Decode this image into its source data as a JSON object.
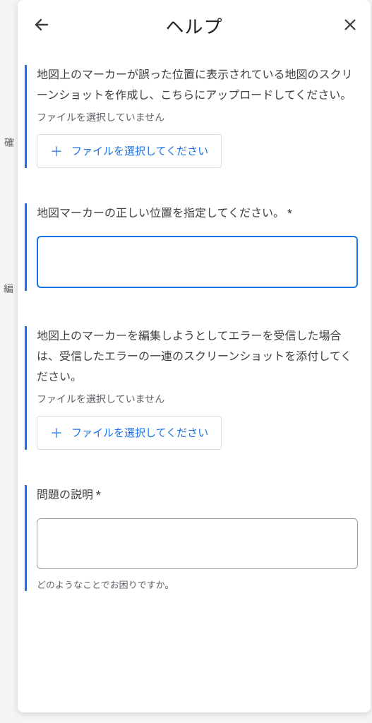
{
  "background": {
    "left1": "確",
    "left2": "編"
  },
  "header": {
    "title": "ヘルプ"
  },
  "section1": {
    "prompt": "地図上のマーカーが誤った位置に表示されている地図のスクリーンショットを作成し、こちらにアップロードしてください。",
    "nofile": "ファイルを選択していません",
    "button": "ファイルを選択してください"
  },
  "section2": {
    "prompt": "地図マーカーの正しい位置を指定してください。 *"
  },
  "section3": {
    "prompt": "地図上のマーカーを編集しようとしてエラーを受信した場合は、受信したエラーの一連のスクリーンショットを添付してください。",
    "nofile": "ファイルを選択していません",
    "button": "ファイルを選択してください"
  },
  "section4": {
    "prompt": "問題の説明 *",
    "helper": "どのようなことでお困りですか。"
  }
}
